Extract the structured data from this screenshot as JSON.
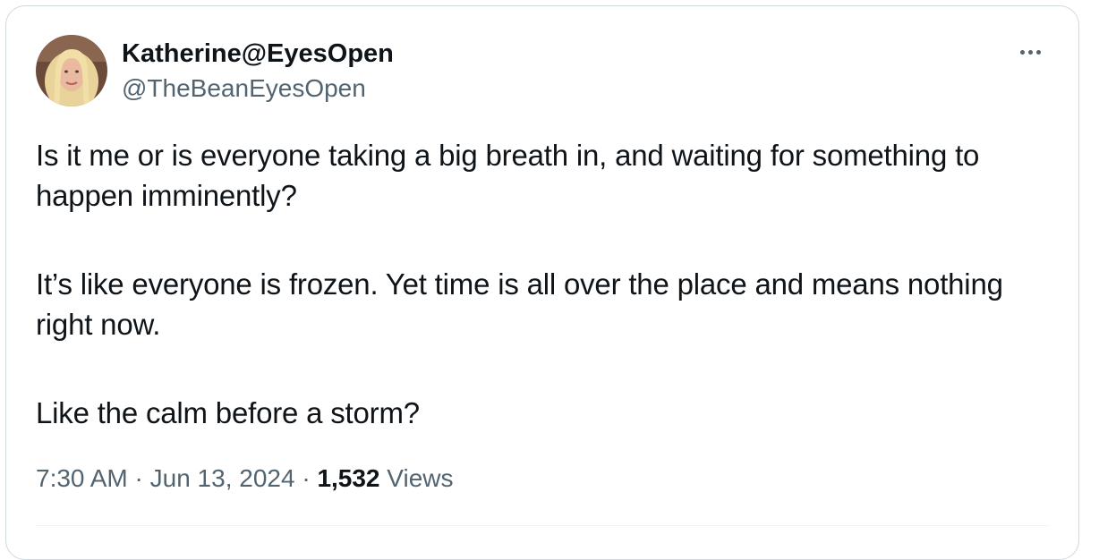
{
  "author": {
    "display_name": "Katherine@EyesOpen",
    "handle": "@TheBeanEyesOpen"
  },
  "tweet": {
    "paragraphs": [
      "Is it me or is everyone taking a big breath in, and waiting for something to happen imminently?",
      "It’s like everyone is frozen. Yet time is all over the place and means nothing right now.",
      "Like the calm before a storm?"
    ]
  },
  "meta": {
    "time": "7:30 AM",
    "separator": "·",
    "date": "Jun 13, 2024",
    "views_count": "1,532",
    "views_label": "Views"
  },
  "icons": {
    "more": "more-horizontal-icon"
  },
  "colors": {
    "text_primary": "#0f1419",
    "text_secondary": "#536471",
    "border": "#cfd9de"
  }
}
